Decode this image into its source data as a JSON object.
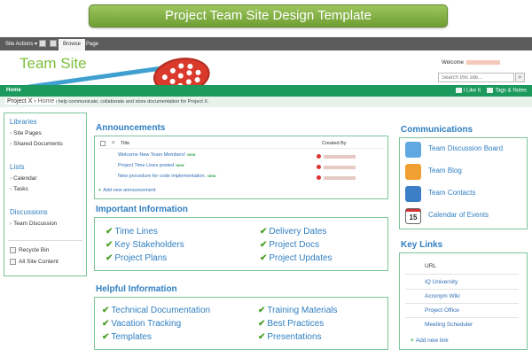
{
  "banner": {
    "title": "Project Team Site Design Template"
  },
  "ribbon": {
    "site_actions": "Site Actions ▾",
    "tabs": [
      {
        "label": "Browse"
      },
      {
        "label": "Page"
      }
    ]
  },
  "header": {
    "logo_text": "Team Site",
    "welcome_label": "Welcome",
    "search_placeholder": "Search this site...",
    "search_icon": "magnifier-icon"
  },
  "topnav": {
    "home": "Home",
    "like": "I Like It",
    "tags": "Tags & Notes"
  },
  "breadcrumb": {
    "site": "Project X",
    "separator": "›",
    "page": "Home"
  },
  "description": "This template is used to help communicate, collaborate and store documentation for Project X.",
  "leftnav": {
    "sections": [
      {
        "heading": "Libraries",
        "items": [
          "Site Pages",
          "Shared Documents"
        ]
      },
      {
        "heading": "Lists",
        "items": [
          "Calendar",
          "Tasks"
        ]
      },
      {
        "heading": "Discussions",
        "items": [
          "Team Discussion"
        ]
      }
    ],
    "utility": [
      {
        "label": "Recycle Bin",
        "icon": "recycle-bin-icon"
      },
      {
        "label": "All Site Content",
        "icon": "site-content-icon"
      }
    ]
  },
  "announcements": {
    "heading": "Announcements",
    "columns": {
      "title": "Title",
      "created_by": "Created By"
    },
    "rows": [
      {
        "title": "Welcome New Team Members!",
        "badge": "NEW"
      },
      {
        "title": "Project Time Lines posted",
        "badge": "NEW"
      },
      {
        "title": "New procedure for code implementation.",
        "badge": "NEW"
      }
    ],
    "add_link": "Add new announcement"
  },
  "important": {
    "heading": "Important Information",
    "left": [
      "Time Lines",
      "Key Stakeholders",
      "Project Plans"
    ],
    "right": [
      "Delivery Dates",
      "Project Docs",
      "Project Updates"
    ]
  },
  "helpful": {
    "heading": "Helpful Information",
    "left": [
      "Technical Documentation",
      "Vacation Tracking",
      "Templates"
    ],
    "right": [
      "Training Materials",
      "Best Practices",
      "Presentations"
    ]
  },
  "communications": {
    "heading": "Communications",
    "items": [
      {
        "label": "Team Discussion Board",
        "icon": "discussion-board-icon"
      },
      {
        "label": "Team Blog",
        "icon": "blog-icon"
      },
      {
        "label": "Team Contacts",
        "icon": "contacts-icon"
      },
      {
        "label": "Calendar of Events",
        "icon": "calendar-icon",
        "icon_text": "15"
      }
    ]
  },
  "key_links": {
    "heading": "Key Links",
    "column": "URL",
    "items": [
      "IQ University",
      "Acronym Wiki",
      "Project Office",
      "Meeting Scheduler"
    ],
    "add_link": "Add new link"
  },
  "colors": {
    "accent_green": "#1c9a5e",
    "heading_blue": "#2f7fc2",
    "border_green": "#7cc49b"
  }
}
